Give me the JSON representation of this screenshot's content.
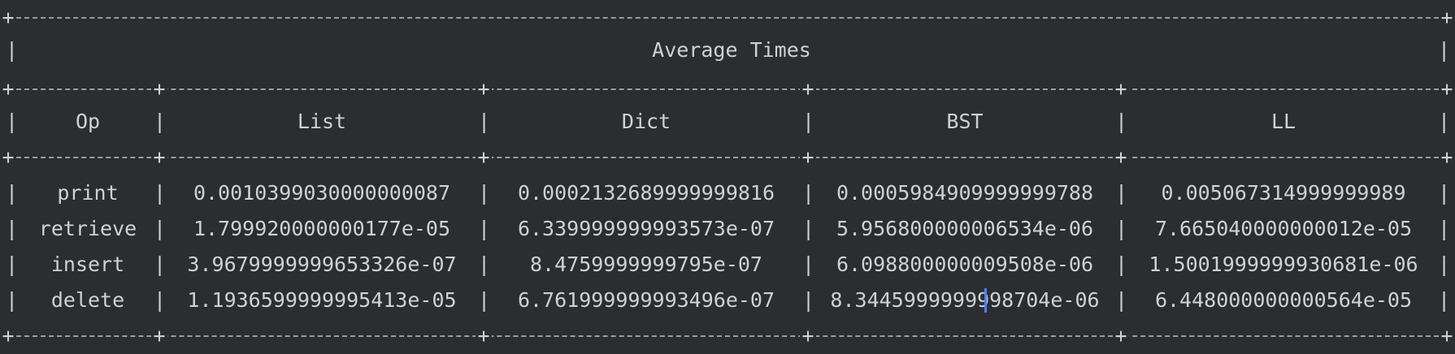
{
  "table": {
    "title": "Average Times",
    "border_char": "+",
    "pipe_char": "|",
    "columns": [
      "Op",
      "List",
      "Dict",
      "BST",
      "LL"
    ],
    "rows": [
      [
        "print",
        "0.0010399030000000087",
        "0.0002132689999999816",
        "0.0005984909999999788",
        "0.005067314999999989"
      ],
      [
        "retrieve",
        "1.799920000000177e-05",
        "6.339999999993573e-07",
        "5.956800000006534e-06",
        "7.665040000000012e-05"
      ],
      [
        "insert",
        "3.9679999999653326e-07",
        "8.4759999999795e-07",
        "6.098800000009508e-06",
        "1.5001999999930681e-06"
      ],
      [
        "delete",
        "1.1936599999995413e-05",
        "6.761999999993496e-07",
        "8.3445999999998704e-06",
        "6.448000000000564e-05"
      ]
    ]
  },
  "colors": {
    "background": "#2b2d30",
    "text": "#cfd1d4",
    "caret": "#4f7ff0"
  }
}
